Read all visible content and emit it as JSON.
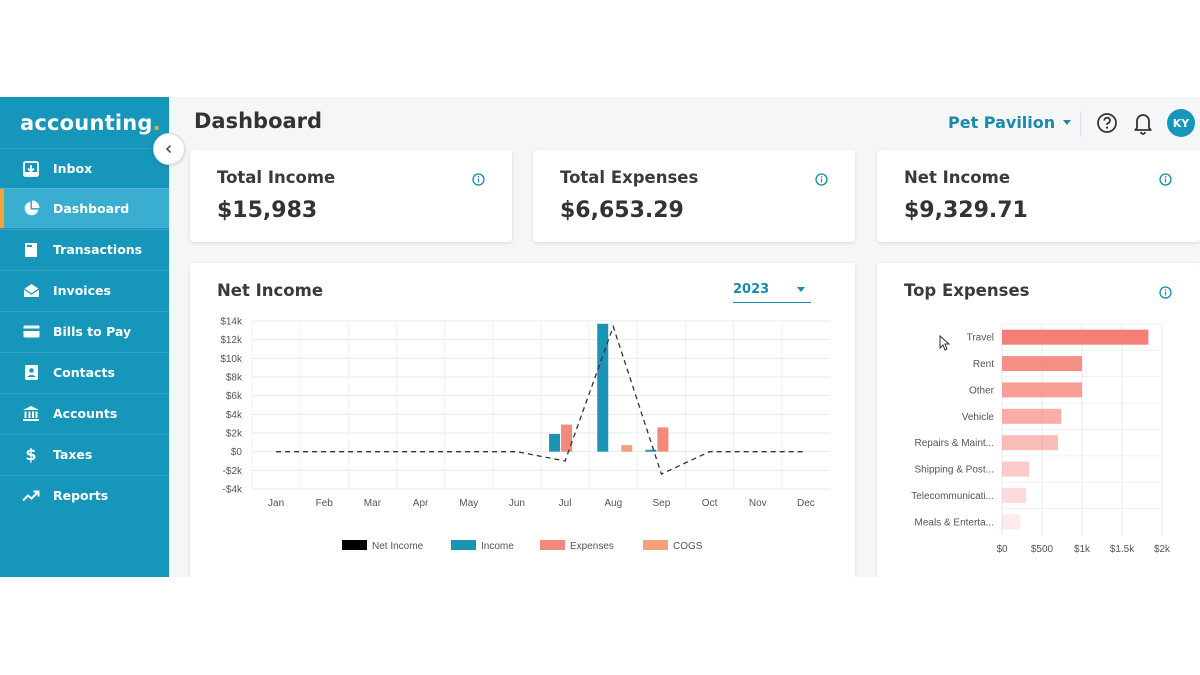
{
  "app": {
    "logo": "accounting",
    "logo_dot": "."
  },
  "sidebar": {
    "items": [
      {
        "label": "Inbox",
        "icon": "inbox-icon"
      },
      {
        "label": "Dashboard",
        "icon": "pie-chart-icon",
        "active": true
      },
      {
        "label": "Transactions",
        "icon": "document-icon"
      },
      {
        "label": "Invoices",
        "icon": "envelope-icon"
      },
      {
        "label": "Bills to Pay",
        "icon": "credit-card-icon"
      },
      {
        "label": "Contacts",
        "icon": "contact-card-icon"
      },
      {
        "label": "Accounts",
        "icon": "bank-icon"
      },
      {
        "label": "Taxes",
        "icon": "dollar-icon"
      },
      {
        "label": "Reports",
        "icon": "trend-icon"
      }
    ]
  },
  "header": {
    "title": "Dashboard",
    "company": "Pet Pavilion",
    "avatar_initials": "KY"
  },
  "summary": {
    "total_income": {
      "label": "Total Income",
      "value": "$15,983"
    },
    "total_expenses": {
      "label": "Total Expenses",
      "value": "$6,653.29"
    },
    "net_income": {
      "label": "Net Income",
      "value": "$9,329.71"
    }
  },
  "net_income_panel": {
    "title": "Net Income",
    "year": "2023"
  },
  "top_expenses_panel": {
    "title": "Top Expenses"
  },
  "colors": {
    "brand": "#1596ba",
    "income": "#1a93b4",
    "expenses": "#f08a7a",
    "cogs": "#f5a07a",
    "net": "#000000",
    "expense_bar": "#f47f74"
  },
  "chart_data": [
    {
      "type": "bar",
      "categories": [
        "Jan",
        "Feb",
        "Mar",
        "Apr",
        "May",
        "Jun",
        "Jul",
        "Aug",
        "Sep",
        "Oct",
        "Nov",
        "Dec"
      ],
      "y_tick_labels": [
        "$14k",
        "$12k",
        "$10k",
        "$8k",
        "$6k",
        "$4k",
        "$2k",
        "$0",
        "-$2k",
        "-$4k"
      ],
      "y_ticks": [
        14000,
        12000,
        10000,
        8000,
        6000,
        4000,
        2000,
        0,
        -2000,
        -4000
      ],
      "ylim": [
        -4000,
        14000
      ],
      "grid": true,
      "legend_position": "bottom",
      "series": [
        {
          "name": "Net Income",
          "kind": "line",
          "values": [
            0,
            0,
            0,
            0,
            0,
            0,
            -1000,
            13400,
            -2400,
            0,
            0,
            0
          ]
        },
        {
          "name": "Income",
          "kind": "bar",
          "values": [
            0,
            0,
            0,
            0,
            0,
            0,
            1900,
            13700,
            200,
            0,
            0,
            0
          ]
        },
        {
          "name": "Expenses",
          "kind": "bar",
          "values": [
            0,
            0,
            0,
            0,
            0,
            0,
            2900,
            0,
            2600,
            0,
            0,
            0
          ]
        },
        {
          "name": "COGS",
          "kind": "bar",
          "values": [
            0,
            0,
            0,
            0,
            0,
            0,
            0,
            700,
            0,
            0,
            0,
            0
          ]
        }
      ]
    },
    {
      "type": "bar",
      "orientation": "horizontal",
      "categories": [
        "Travel",
        "Rent",
        "Other",
        "Vehicle",
        "Repairs & Maint...",
        "Shipping & Post...",
        "Telecommunicati...",
        "Meals & Enterta..."
      ],
      "values": [
        1830,
        1000,
        1000,
        740,
        700,
        340,
        300,
        230
      ],
      "x_tick_labels": [
        "$0",
        "$500",
        "$1k",
        "$1.5k",
        "$2k"
      ],
      "x_ticks": [
        0,
        500,
        1000,
        1500,
        2000
      ],
      "xlim": [
        0,
        2000
      ],
      "grid": true
    }
  ]
}
